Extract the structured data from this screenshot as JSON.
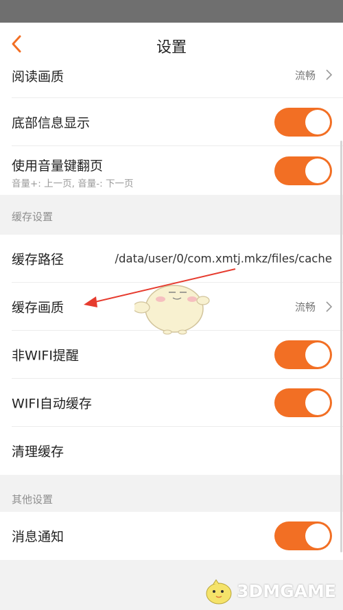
{
  "nav": {
    "title": "设置",
    "back_icon": "chevron-left-icon"
  },
  "colors": {
    "accent": "#f26f24",
    "status_bar": "#6f6f6f",
    "background": "#f2f2f2"
  },
  "rows_top": [
    {
      "label": "阅读画质",
      "value": "流畅"
    },
    {
      "label": "底部信息显示",
      "toggle": true
    },
    {
      "label": "使用音量键翻页",
      "sub": "音量+: 上一页, 音量-: 下一页",
      "toggle": true
    }
  ],
  "section_cache": {
    "title": "缓存设置",
    "rows": [
      {
        "label": "缓存路径",
        "value": "/data/user/0/com.xmtj.mkz/files/cache"
      },
      {
        "label": "缓存画质",
        "value": "流畅"
      },
      {
        "label": "非WIFI提醒",
        "toggle": true
      },
      {
        "label": "WIFI自动缓存",
        "toggle": true
      },
      {
        "label": "清理缓存"
      }
    ]
  },
  "section_other": {
    "title": "其他设置",
    "rows": [
      {
        "label": "消息通知",
        "toggle": true
      }
    ]
  },
  "watermark": {
    "text": "3DMGAME"
  }
}
